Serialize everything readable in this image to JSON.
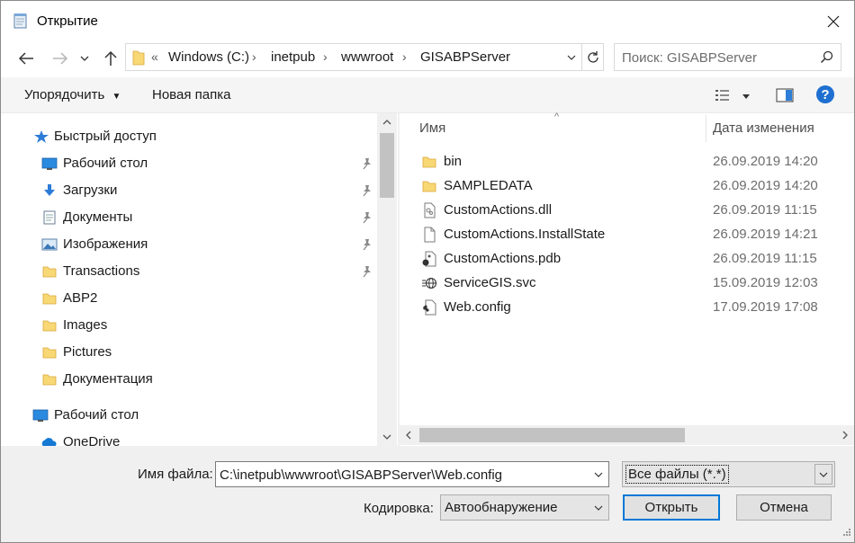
{
  "window": {
    "title": "Открытие"
  },
  "address": {
    "overflow": "«",
    "crumbs": [
      "Windows (C:)",
      "inetpub",
      "wwwroot",
      "GISABPServer"
    ],
    "search_placeholder": "Поиск: GISABPServer"
  },
  "toolbar": {
    "organize_label": "Упорядочить",
    "new_folder_label": "Новая папка",
    "view_icon": "details-view-icon",
    "preview_icon": "preview-pane-icon",
    "help_icon": "help-icon"
  },
  "nav": {
    "items": [
      {
        "label": "Быстрый доступ",
        "icon": "star-icon",
        "pinned": false
      },
      {
        "label": "Рабочий стол",
        "icon": "desktop-icon",
        "pinned": true
      },
      {
        "label": "Загрузки",
        "icon": "download-icon",
        "pinned": true
      },
      {
        "label": "Документы",
        "icon": "documents-icon",
        "pinned": true
      },
      {
        "label": "Изображения",
        "icon": "pictures-icon",
        "pinned": true
      },
      {
        "label": "Transactions",
        "icon": "folder-icon",
        "pinned": true
      },
      {
        "label": "ABP2",
        "icon": "folder-icon",
        "pinned": false
      },
      {
        "label": "Images",
        "icon": "folder-icon",
        "pinned": false
      },
      {
        "label": "Pictures",
        "icon": "folder-icon",
        "pinned": false
      },
      {
        "label": "Документация",
        "icon": "folder-icon",
        "pinned": false
      },
      {
        "label": "Рабочий стол",
        "icon": "desktop-icon",
        "pinned": false
      },
      {
        "label": "OneDrive",
        "icon": "onedrive-icon",
        "pinned": false
      }
    ]
  },
  "files": {
    "columns": {
      "name": "Имя",
      "date": "Дата изменения"
    },
    "rows": [
      {
        "name": "bin",
        "date": "26.09.2019 14:20",
        "icon": "folder-icon"
      },
      {
        "name": "SAMPLEDATA",
        "date": "26.09.2019 14:20",
        "icon": "folder-icon"
      },
      {
        "name": "CustomActions.dll",
        "date": "26.09.2019 11:15",
        "icon": "dll-file-icon"
      },
      {
        "name": "CustomActions.InstallState",
        "date": "26.09.2019 14:21",
        "icon": "blank-file-icon"
      },
      {
        "name": "CustomActions.pdb",
        "date": "26.09.2019 11:15",
        "icon": "pdb-file-icon"
      },
      {
        "name": "ServiceGIS.svc",
        "date": "15.09.2019 12:03",
        "icon": "svc-file-icon"
      },
      {
        "name": "Web.config",
        "date": "17.09.2019 17:08",
        "icon": "config-file-icon"
      }
    ]
  },
  "bottom": {
    "filename_label": "Имя файла:",
    "filename_value": "C:\\inetpub\\wwwroot\\GISABPServer\\Web.config",
    "filetype_value": "Все файлы  (*.*)",
    "encoding_label": "Кодировка:",
    "encoding_value": "Автообнаружение",
    "open_label": "Открыть",
    "cancel_label": "Отмена"
  },
  "colors": {
    "accent": "#0078d7",
    "folder": "#f8d775",
    "help": "#1f6fd1"
  }
}
